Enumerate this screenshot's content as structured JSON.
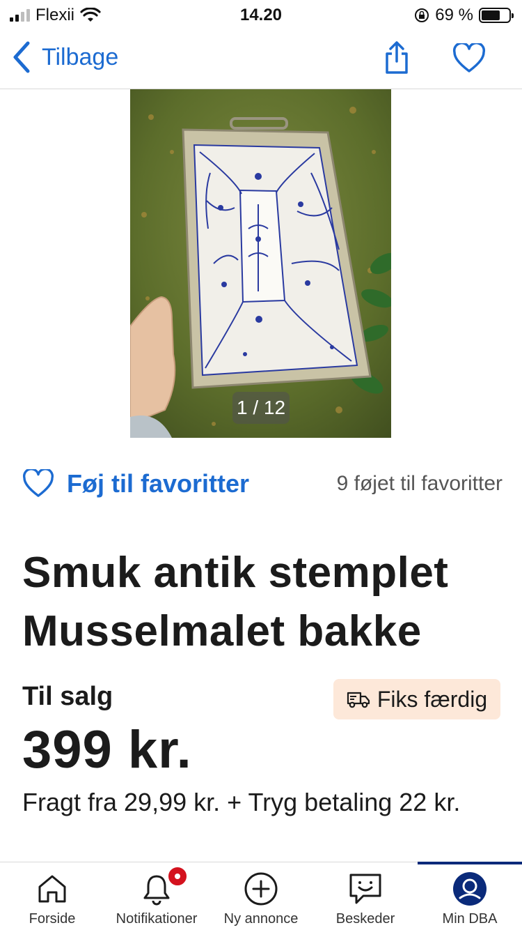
{
  "status_bar": {
    "carrier": "Flexii",
    "time": "14.20",
    "battery_text": "69 %"
  },
  "nav": {
    "back_label": "Tilbage"
  },
  "photo": {
    "counter": "1 / 12"
  },
  "favorites": {
    "add_label": "Føj til favoritter",
    "count_text": "9 føjet til favoritter"
  },
  "ad": {
    "title": "Smuk antik stemplet Musselmalet bakke",
    "sale_type": "Til salg",
    "fiks_label": "Fiks færdig",
    "price": "399 kr.",
    "shipping": "Fragt fra 29,99 kr. + Tryg betaling 22 kr."
  },
  "tab_bar": {
    "items": [
      {
        "label": "Forside",
        "icon": "home-icon"
      },
      {
        "label": "Notifikationer",
        "icon": "bell-icon"
      },
      {
        "label": "Ny annonce",
        "icon": "plus-circle-icon"
      },
      {
        "label": "Beskeder",
        "icon": "chat-icon"
      },
      {
        "label": "Min DBA",
        "icon": "profile-icon"
      }
    ],
    "active": "Min DBA"
  },
  "colors": {
    "accent_blue": "#1c6bd1",
    "badge_bg": "#fde8d9",
    "notification_red": "#d4121e",
    "active_tab_navy": "#0a2a7a"
  }
}
